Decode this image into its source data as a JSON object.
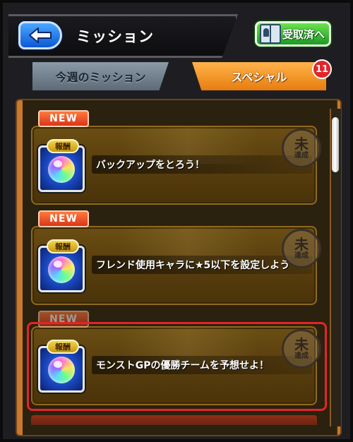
{
  "header": {
    "title": "ミッション",
    "received_button_label": "受取済へ"
  },
  "tabs": [
    {
      "label": "今週のミッション",
      "active": false
    },
    {
      "label": "スペシャル",
      "active": true,
      "badge": "11"
    }
  ],
  "missions": [
    {
      "tag": "NEW",
      "reward_label": "報酬",
      "text": "バックアップをとろう！",
      "status": "未達成"
    },
    {
      "tag": "NEW",
      "reward_label": "報酬",
      "text": "フレンド使用キャラに★5以下を設定しよう",
      "status": "未達成"
    },
    {
      "tag": "NEW",
      "reward_label": "報酬",
      "text": "モンストGPの優勝チームを予想せよ！",
      "status": "未達成",
      "selected": true
    }
  ],
  "colors": {
    "accent_orange": "#f08a1e",
    "badge_red": "#e0262b",
    "selection_red": "#e4242a",
    "back_blue": "#1a6fe8",
    "received_green": "#2fb02e"
  },
  "icons": {
    "back": "arrow-left-icon",
    "received": "book-icon",
    "reward": "orb-icon",
    "status": "stamp-icon"
  }
}
